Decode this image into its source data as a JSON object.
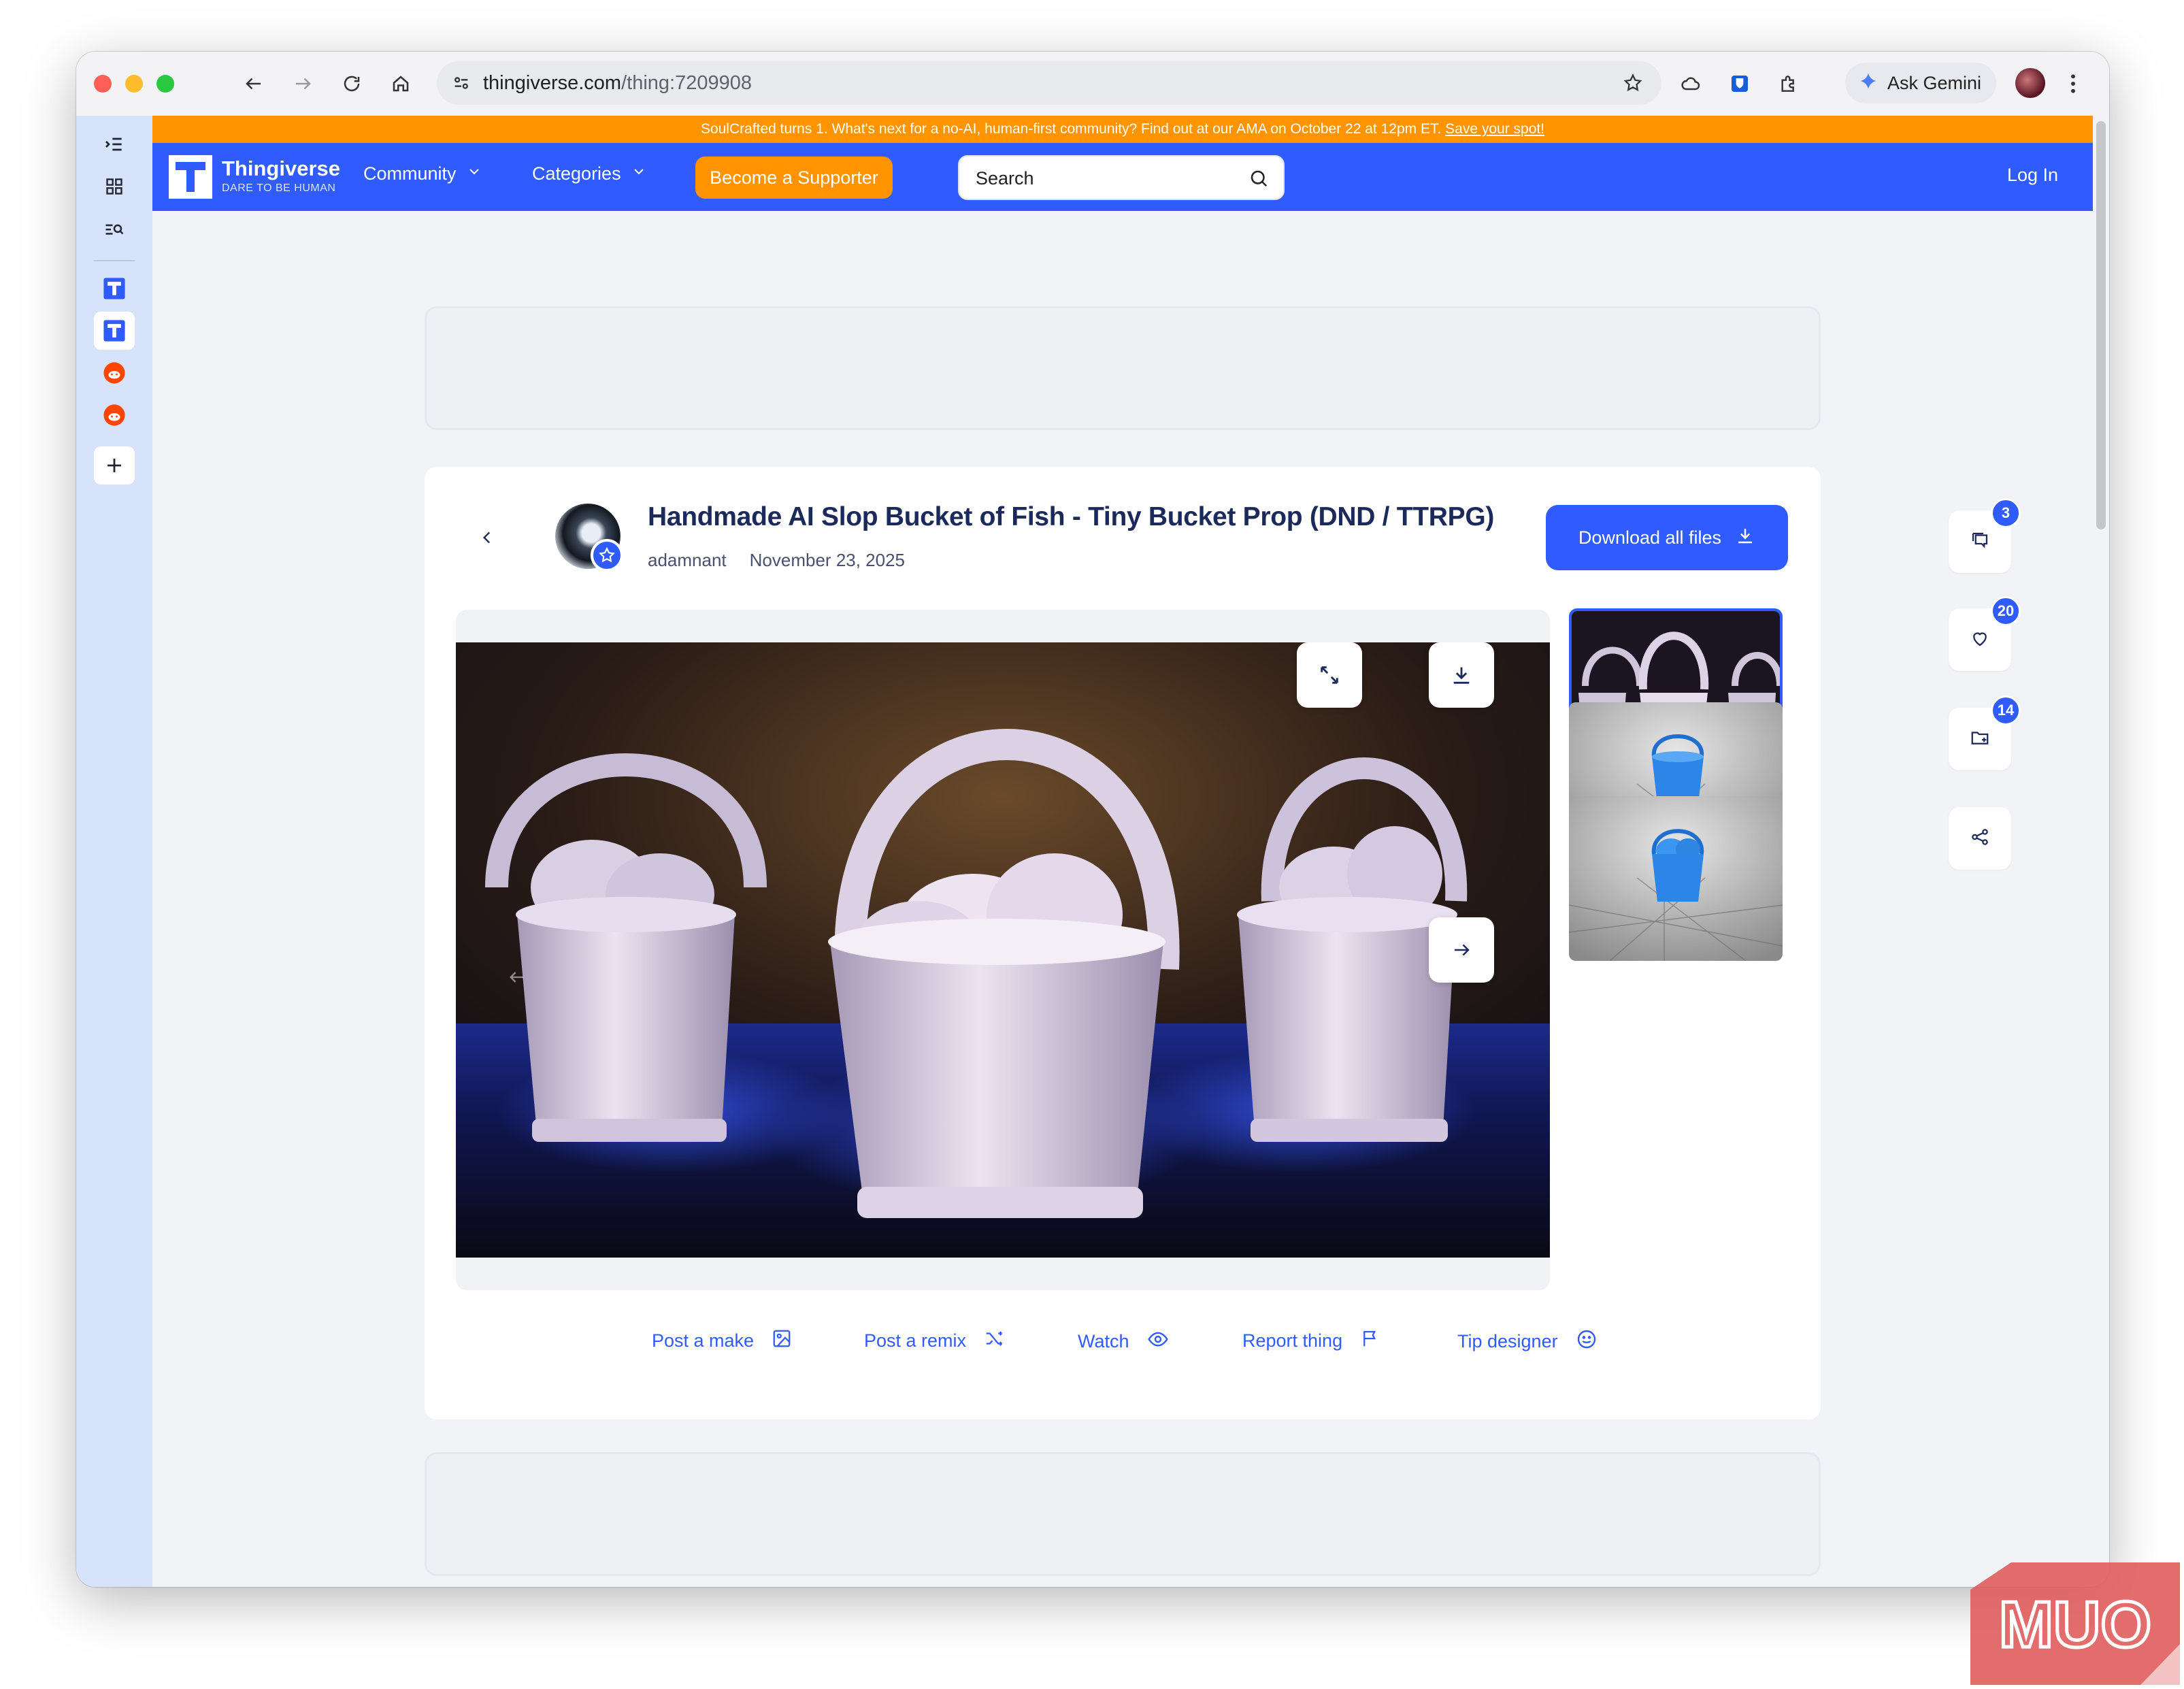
{
  "browser": {
    "url_host": "thingiverse.com",
    "url_path": "/thing:7209908",
    "gemini_label": "Ask Gemini"
  },
  "site": {
    "banner_text": "SoulCrafted turns 1. What's next for a no-AI, human-first community? Find out at our AMA on October 22 at 12pm ET.",
    "banner_link": "Save your spot!",
    "logo_name": "Thingiverse",
    "logo_tagline": "DARE TO BE HUMAN",
    "nav_community": "Community",
    "nav_categories": "Categories",
    "supporter_label": "Become a Supporter",
    "search_placeholder": "Search",
    "login_label": "Log In",
    "brand_color": "#2f5bff",
    "accent_color": "#ff9300"
  },
  "thing": {
    "title": "Handmade AI Slop Bucket of Fish - Tiny Bucket Prop (DND / TTRPG)",
    "author": "adamnant",
    "date": "November 23, 2025",
    "download_label": "Download all files",
    "thumbnails": [
      {
        "name": "render-white-buckets",
        "active": true
      },
      {
        "name": "render-blue-bucket-empty",
        "active": false
      },
      {
        "name": "render-blue-bucket-fish",
        "active": false
      }
    ]
  },
  "actions": {
    "post_make": "Post a make",
    "post_remix": "Post a remix",
    "watch": "Watch",
    "report": "Report thing",
    "tip": "Tip designer"
  },
  "side": {
    "comments_count": "3",
    "likes_count": "20",
    "collections_count": "14"
  },
  "watermark": "MUO"
}
